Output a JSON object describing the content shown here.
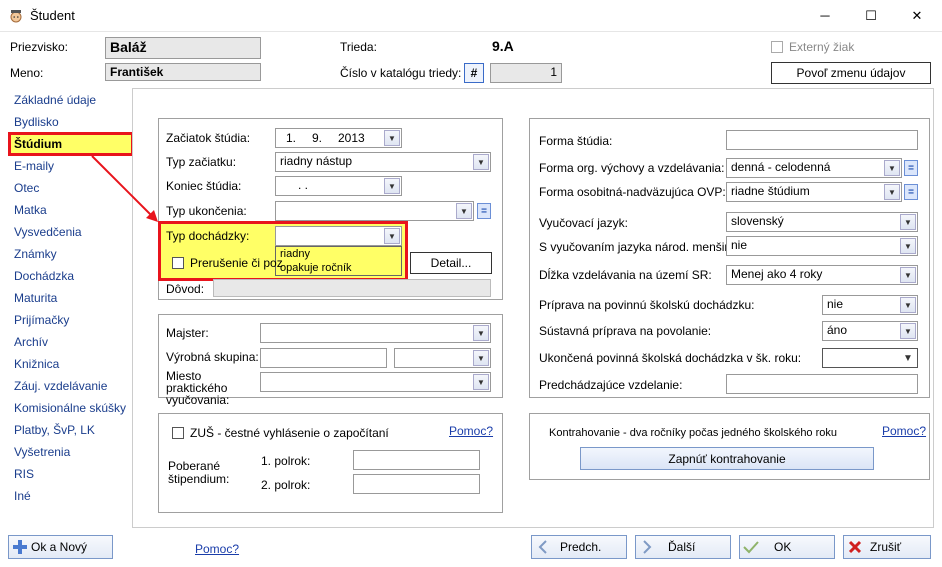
{
  "window": {
    "title": "Študent",
    "minimize": "─",
    "maximize": "☐",
    "close": "✕"
  },
  "header": {
    "surname_label": "Priezvisko:",
    "surname_value": "Baláž",
    "name_label": "Meno:",
    "name_value": "František",
    "class_label": "Trieda:",
    "class_value": "9.A",
    "catalog_label": "Číslo v katalógu triedy:",
    "catalog_hash": "#",
    "catalog_value": "1",
    "external_label": "Externý žiak",
    "allow_change_button": "Povoľ zmenu údajov"
  },
  "sidebar": {
    "items": [
      "Základné údaje",
      "Bydlisko",
      "Štúdium",
      "E-maily",
      "Otec",
      "Matka",
      "Vysvedčenia",
      "Známky",
      "Dochádzka",
      "Maturita",
      "Prijímačky",
      "Archív",
      "Knižnica",
      "Záuj. vzdelávanie",
      "Komisionálne skúšky",
      "Platby, ŠvP, LK",
      "Vyšetrenia",
      "RIS",
      "Iné"
    ],
    "selected": "Štúdium"
  },
  "study": {
    "start_label": "Začiatok štúdia:",
    "start_day": "1.",
    "start_month": "9.",
    "start_year": "2013",
    "start_type_label": "Typ začiatku:",
    "start_type_value": "riadny nástup",
    "end_label": "Koniec štúdia:",
    "end_value": ".        .",
    "end_type_label": "Typ ukončenia:",
    "end_type_value": "",
    "attendance_label": "Typ dochádzky:",
    "attendance_value": "",
    "attendance_options": [
      "riadny",
      "opakuje ročník"
    ],
    "interruption_label": "Prerušenie či poz",
    "detail_button": "Detail...",
    "reason_label": "Dôvod:"
  },
  "master": {
    "master_label": "Majster:",
    "production_group_label": "Výrobná skupina:",
    "practice_place_label": "Miesto praktického vyučovania:"
  },
  "zus": {
    "label": "ZUŠ - čestné vyhlásenie o započítaní",
    "help": "Pomoc?",
    "scholarship_label": "Poberané štipendium:",
    "half1_label": "1. polrok:",
    "half2_label": "2. polrok:"
  },
  "form": {
    "form_label": "Forma štúdia:",
    "form_value": "",
    "org_label": "Forma org. výchovy a vzdelávania:",
    "org_value": "denná - celodenná",
    "ovp_label": "Forma osobitná-nadväzujúca OVP:",
    "ovp_value": "riadne štúdium",
    "lang_label": "Vyučovací jazyk:",
    "lang_value": "slovenský",
    "minority_label": "S vyučovaním jazyka národ. menšiny:",
    "minority_value": "nie",
    "length_label": "Dĺžka vzdelávania na území SR:",
    "length_value": "Menej ako 4 roky",
    "prep_label": "Príprava na povinnú školskú dochádzku:",
    "prep_value": "nie",
    "system_label": "Sústavná príprava na povolanie:",
    "system_value": "áno",
    "finished_label": "Ukončená povinná školská dochádzka v šk. roku:",
    "finished_value": "",
    "previous_label": "Predchádzajúce vzdelanie:",
    "previous_value": "",
    "equals": "="
  },
  "contract": {
    "label": "Kontrahovanie - dva ročníky počas jedného školského roku",
    "help": "Pomoc?",
    "button": "Zapnúť kontrahovanie"
  },
  "footer": {
    "ok_new": "Ok a Nový",
    "help": "Pomoc?",
    "prev": "Predch.",
    "next": "Ďalší",
    "ok": "OK",
    "cancel": "Zrušiť"
  },
  "colors": {
    "highlight_border": "#e8141c",
    "highlight_fill": "#ffff66",
    "sidebar_link": "#1a3d8c"
  }
}
